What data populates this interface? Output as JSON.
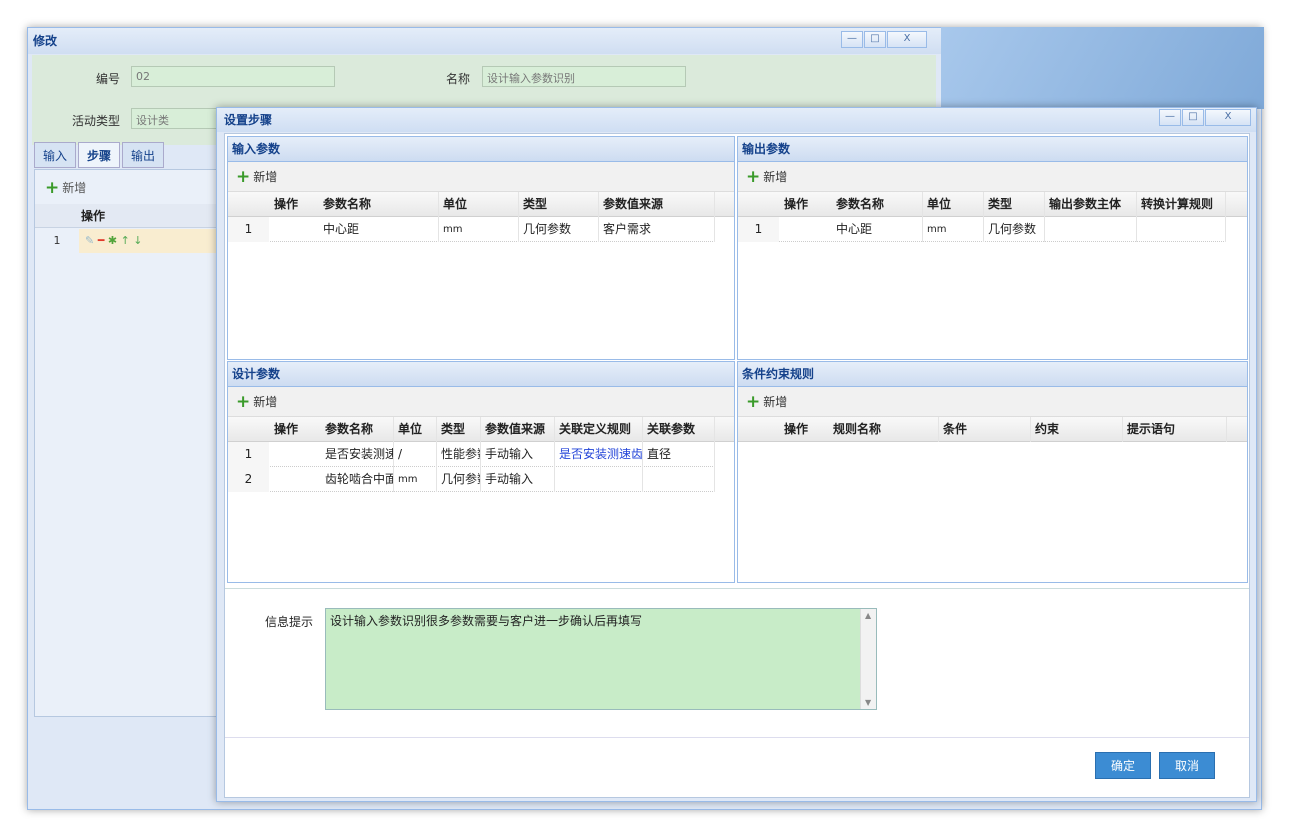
{
  "bg_window": {
    "title": "修改",
    "number_label": "编号",
    "number_value": "02",
    "name_label": "名称",
    "name_value": "设计输入参数识别",
    "activity_type_label": "活动类型",
    "activity_type_value": "设计类",
    "tabs": [
      "输入",
      "步骤",
      "输出"
    ],
    "add_label": "新增",
    "op_header": "操作",
    "row_number": "1"
  },
  "dialog": {
    "title": "设置步骤",
    "window_buttons": [
      "—",
      "□",
      "X"
    ],
    "input_params": {
      "title": "输入参数",
      "add_label": "新增",
      "columns": [
        "操作",
        "参数名称",
        "单位",
        "类型",
        "参数值来源"
      ],
      "rows": [
        {
          "n": "1",
          "name": "中心距",
          "unit": "mm",
          "type": "几何参数",
          "source": "客户需求"
        }
      ]
    },
    "output_params": {
      "title": "输出参数",
      "add_label": "新增",
      "columns": [
        "操作",
        "参数名称",
        "单位",
        "类型",
        "输出参数主体",
        "转换计算规则"
      ],
      "rows": [
        {
          "n": "1",
          "name": "中心距",
          "unit": "mm",
          "type": "几何参数",
          "subject": "",
          "rule": ""
        }
      ]
    },
    "design_params": {
      "title": "设计参数",
      "add_label": "新增",
      "columns": [
        "操作",
        "参数名称",
        "单位",
        "类型",
        "参数值来源",
        "关联定义规则",
        "关联参数"
      ],
      "rows": [
        {
          "n": "1",
          "name": "是否安装测速",
          "unit": "/",
          "type": "性能参数",
          "source": "手动输入",
          "rule": "是否安装测速齿",
          "param": "直径"
        },
        {
          "n": "2",
          "name": "齿轮啮合中面",
          "unit": "mm",
          "type": "几何参数",
          "source": "手动输入",
          "rule": "",
          "param": ""
        }
      ]
    },
    "constraints": {
      "title": "条件约束规则",
      "add_label": "新增",
      "columns": [
        "操作",
        "规则名称",
        "条件",
        "约束",
        "提示语句"
      ]
    },
    "info": {
      "label": "信息提示",
      "text": "设计输入参数识别很多参数需要与客户进一步确认后再填写"
    },
    "confirm_label": "确定",
    "cancel_label": "取消"
  },
  "icons": {
    "remove": "minus-icon",
    "config": "gear-icon",
    "help": "help-icon",
    "edit": "pencil-icon",
    "up": "arrow-up-icon",
    "down": "arrow-down-icon",
    "add": "plus-icon"
  },
  "colors": {
    "accent": "#15428b",
    "button": "#3c8cd3",
    "info_bg": "#c8ecc8",
    "remove": "#e23a2a",
    "gear": "#52a43a"
  }
}
